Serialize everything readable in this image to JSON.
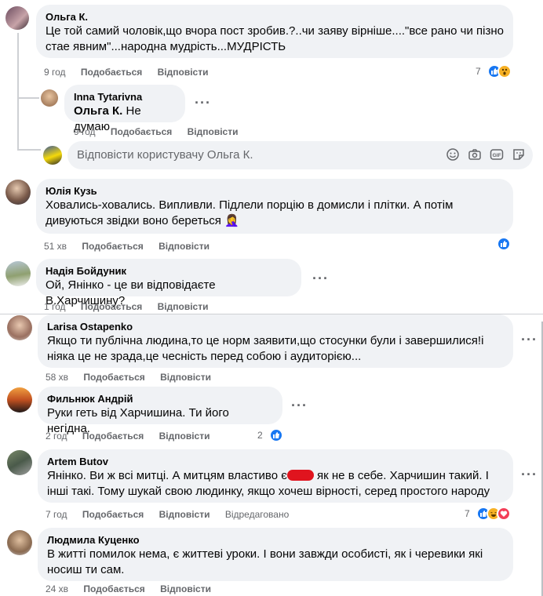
{
  "actions": {
    "like": "Подобається",
    "reply": "Відповісти",
    "edited": "Відредаговано"
  },
  "comments": [
    {
      "author": "Ольга К.",
      "text": "Це той самий чоловік,що вчора пост зробив.?..чи заяву вірніше....\"все рано чи пізно стае явним\"...народна мудрість...МУДРІСТЬ",
      "time": "9 год",
      "reactions_count": "7"
    },
    {
      "author": "Inna Tytarivna",
      "mention": "Ольга К.",
      "text": " Не думаю",
      "time": "9 год"
    },
    {
      "author": "Юлія Кузь",
      "text": "Ховались-ховались. Випливли. Підлели порцію в домисли і плітки. А потім дивуються звідки воно береться 🤦‍♀️",
      "time": "51 хв"
    },
    {
      "author": "Надія Бойдуник",
      "text": "Ой, Янінко - це ви відповідаєте В.Харчишину?",
      "time": "1 год"
    },
    {
      "author": "Larisa Ostapenko",
      "text": "Якщо ти публічна людина,то це норм заявити,що стосунки були і завершилися!і ніяка це не зрада,це чесність перед собою і аудиторією...",
      "time": "58 хв"
    },
    {
      "author": "Фильнюк Андрій",
      "text": "Руки геть від Харчишина. Ти його негідна.",
      "time": "2 год",
      "reactions_count": "2"
    },
    {
      "author": "Artem Butov",
      "text_before": "Янінко. Ви ж всі митці. А митцям властиво є",
      "text_after": " як не в себе. Харчишин такий. І інші такі. Тому шукай свою людинку, якщо хочеш вірності, серед простого народу",
      "time": "7 год",
      "reactions_count": "7"
    },
    {
      "author": "Людмила Куценко",
      "text": "В житті помилок нема, є життеві уроки. І вони завжди особисті, як і черевики які носиш ти сам.",
      "time": "24 хв"
    }
  ],
  "reply_box": {
    "placeholder": "Відповісти користувачу Ольга К."
  },
  "icons": [
    "more-icon",
    "like-reaction-icon",
    "wow-reaction-icon",
    "haha-reaction-icon",
    "love-reaction-icon",
    "emoji-icon",
    "camera-icon",
    "gif-icon",
    "sticker-icon"
  ],
  "colors": {
    "like": "#1877f2",
    "wow": "#f7b125",
    "love": "#f33e58",
    "bubble": "#f0f2f5",
    "meta": "#65676b"
  }
}
